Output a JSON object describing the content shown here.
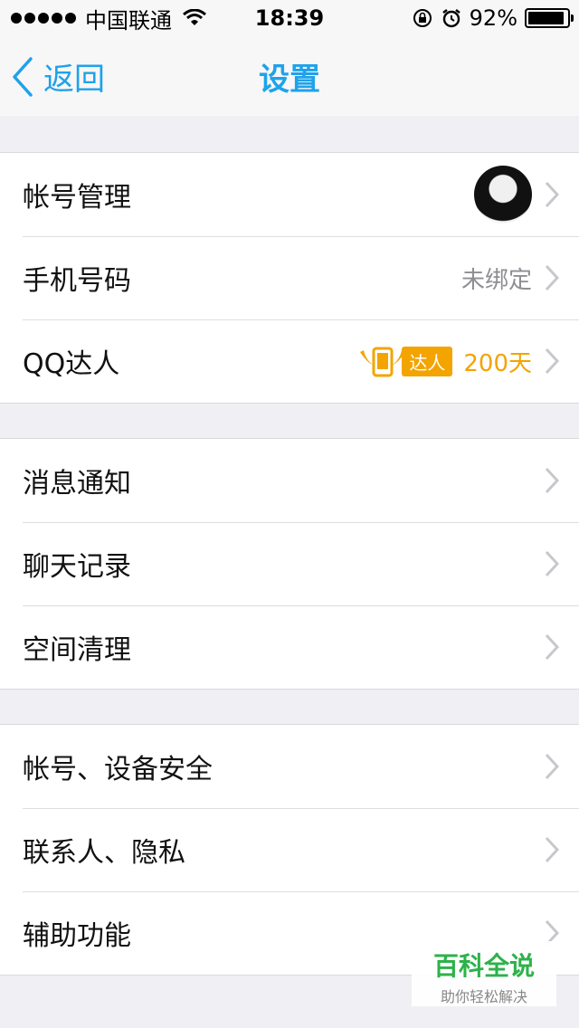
{
  "status_bar": {
    "carrier": "中国联通",
    "time": "18:39",
    "battery_percent_text": "92%",
    "battery_level": 0.92
  },
  "nav": {
    "back_label": "返回",
    "title": "设置"
  },
  "groups": [
    {
      "rows": [
        {
          "label": "帐号管理",
          "right_type": "avatar"
        },
        {
          "label": "手机号码",
          "right_text": "未绑定"
        },
        {
          "label": "QQ达人",
          "right_type": "badge",
          "badge_text": "达人",
          "badge_days": "200天"
        }
      ]
    },
    {
      "rows": [
        {
          "label": "消息通知"
        },
        {
          "label": "聊天记录"
        },
        {
          "label": "空间清理"
        }
      ]
    },
    {
      "rows": [
        {
          "label": "帐号、设备安全"
        },
        {
          "label": "联系人、隐私"
        },
        {
          "label": "辅助功能"
        }
      ]
    }
  ],
  "watermark": {
    "title": "百科全说",
    "subtitle": "助你轻松解决"
  },
  "colors": {
    "accent": "#1fa2ea",
    "badge": "#f3a400",
    "watermark_green": "#2db24a"
  }
}
